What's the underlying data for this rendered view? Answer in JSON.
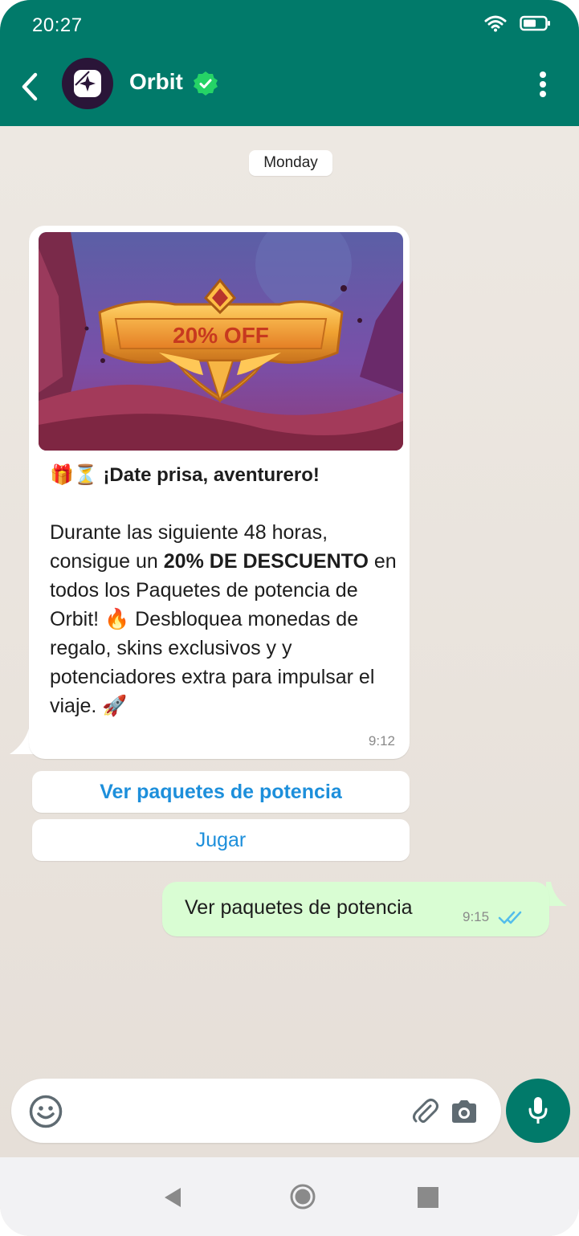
{
  "status_bar": {
    "time": "20:27",
    "wifi_icon": "wifi-icon",
    "battery_icon": "battery-icon"
  },
  "header": {
    "contact_name": "Orbit",
    "verified_icon": "verified-check-icon",
    "back_icon": "arrow-back-icon",
    "menu_icon": "more-vertical-icon",
    "brand_color": "#017a6a"
  },
  "chat": {
    "day_label": "Monday",
    "incoming": {
      "promo_image_text": "20% OFF",
      "title_emoji": "🎁⏳",
      "title": "¡Date prisa, aventurero!",
      "body_part1": "Durante las siguiente 48 horas, consigue un ",
      "body_bold": "20% DE DESCUENTO",
      "body_part2": " en todos los Paquetes de potencia de Orbit! 🔥 Desbloquea monedas de regalo, skins exclusivos y y potenciadores extra para impulsar el viaje. 🚀",
      "time": "9:12"
    },
    "quick_replies": [
      {
        "label": "Ver paquetes de potencia"
      },
      {
        "label": "Jugar"
      }
    ],
    "outgoing": {
      "text": "Ver paquetes de potencia",
      "time": "9:15",
      "status_icon": "double-check-icon",
      "tick_color": "#53bdeb",
      "bubble_color": "#d9fdd3"
    }
  },
  "composer": {
    "placeholder": "",
    "emoji_icon": "emoji-icon",
    "attach_icon": "paperclip-icon",
    "camera_icon": "camera-icon",
    "mic_icon": "mic-icon"
  },
  "nav_bar": {
    "back": "nav-back-icon",
    "home": "nav-home-icon",
    "recents": "nav-recents-icon"
  }
}
